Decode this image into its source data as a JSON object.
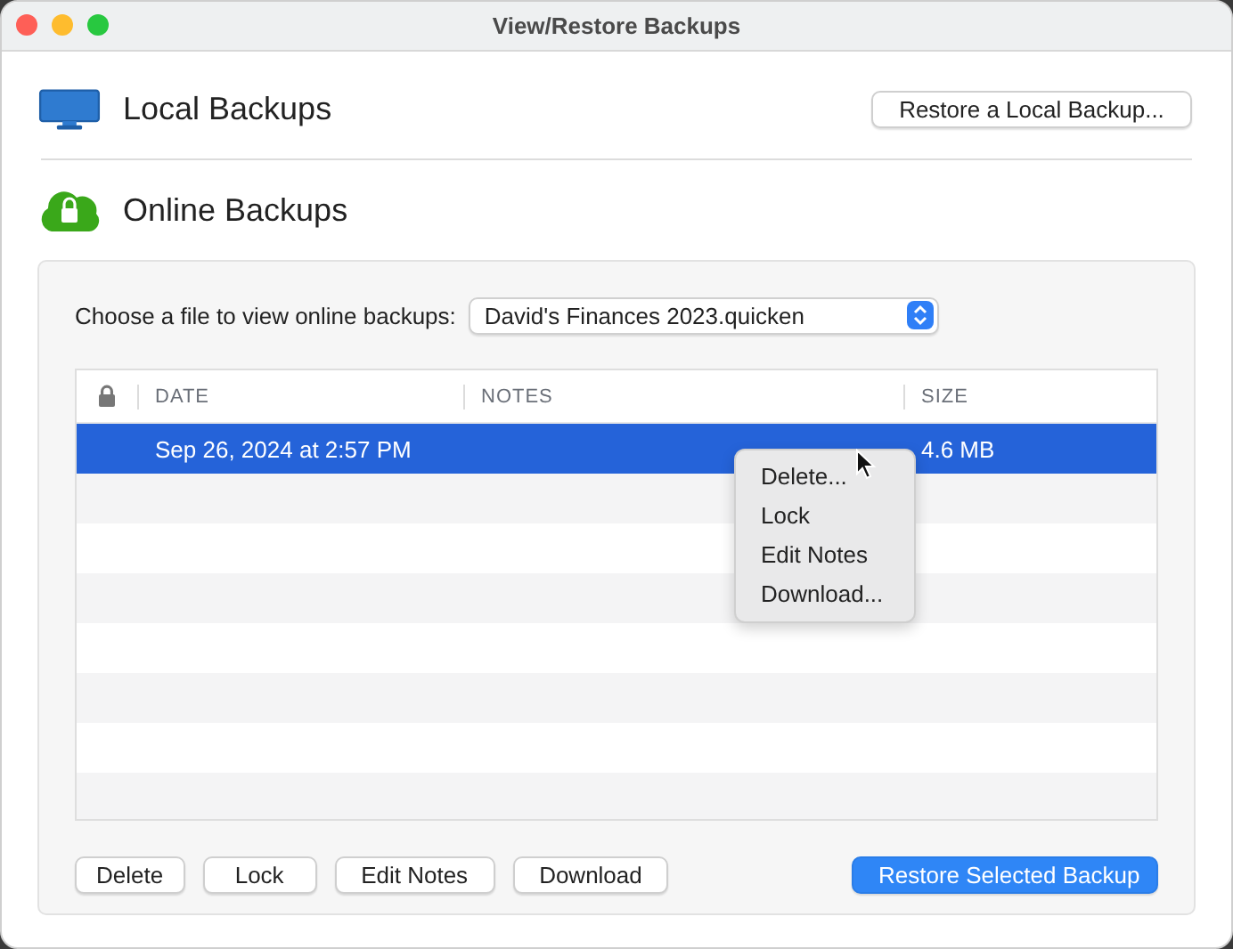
{
  "window": {
    "title": "View/Restore Backups"
  },
  "local": {
    "title": "Local Backups",
    "button": "Restore a Local Backup..."
  },
  "online": {
    "title": "Online Backups",
    "file_label": "Choose a file to view online backups:",
    "file_value": "David's Finances 2023.quicken"
  },
  "table": {
    "columns": [
      "DATE",
      "NOTES",
      "SIZE"
    ],
    "rows": [
      {
        "date": "Sep 26, 2024 at 2:57 PM",
        "notes": "",
        "size": "4.6 MB",
        "selected": true,
        "locked": false
      }
    ]
  },
  "context_menu": [
    "Delete...",
    "Lock",
    "Edit Notes",
    "Download..."
  ],
  "buttons": [
    {
      "label": "Delete",
      "kind": "default"
    },
    {
      "label": "Lock",
      "kind": "default"
    },
    {
      "label": "Edit Notes",
      "kind": "default"
    },
    {
      "label": "Download",
      "kind": "default"
    },
    {
      "label": "Restore Selected Backup",
      "kind": "primary"
    }
  ]
}
